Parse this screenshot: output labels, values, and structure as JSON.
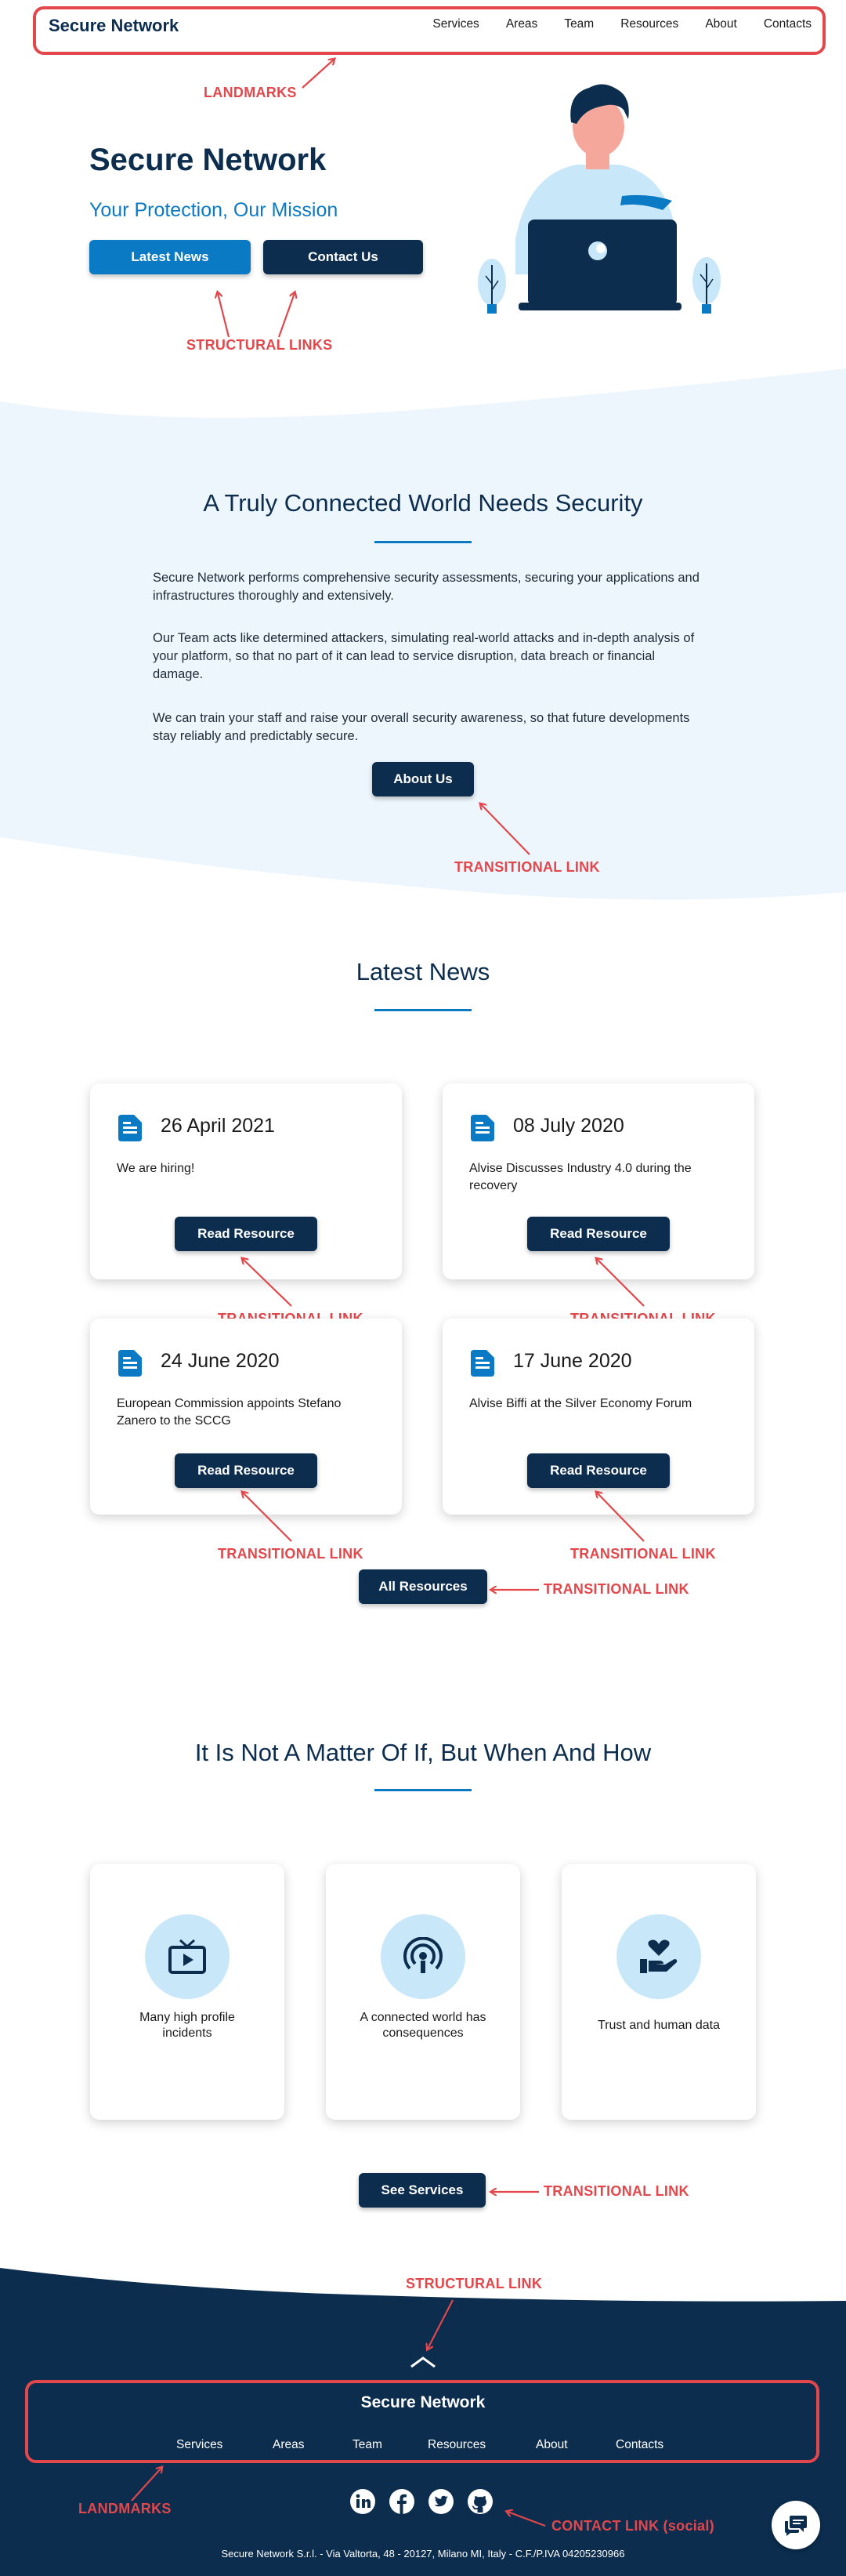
{
  "header": {
    "brand": "Secure Network",
    "nav": [
      "Services",
      "Areas",
      "Team",
      "Resources",
      "About",
      "Contacts"
    ]
  },
  "hero": {
    "title": "Secure Network",
    "subtitle": "Your Protection, Our Mission",
    "btn_news": "Latest News",
    "btn_contact": "Contact Us"
  },
  "security": {
    "title": "A Truly Connected World Needs Security",
    "paragraphs": [
      "Secure Network performs comprehensive security assessments, securing your applications and infrastructures thoroughly and extensively.",
      "Our Team acts like determined attackers, simulating real-world attacks and in-depth analysis of your platform, so that no part of it can lead to service disruption, data breach or financial damage.",
      "We can train your staff and raise your overall security awareness, so that future developments stay reliably and predictably secure."
    ],
    "button": "About Us"
  },
  "news": {
    "title": "Latest News",
    "items": [
      {
        "date": "26 April 2021",
        "text": "We are hiring!",
        "button": "Read Resource"
      },
      {
        "date": "08 July 2020",
        "text": "Alvise Discusses Industry 4.0 during the recovery",
        "button": "Read Resource"
      },
      {
        "date": "24 June 2020",
        "text": "European Commission appoints Stefano Zanero to the SCCG",
        "button": "Read Resource"
      },
      {
        "date": "17 June 2020",
        "text": "Alvise Biffi at the Silver Economy Forum",
        "button": "Read Resource"
      }
    ],
    "all_button": "All Resources"
  },
  "how": {
    "title": "It Is Not A Matter Of If, But When And How",
    "cards": [
      {
        "icon": "tv-play-icon",
        "caption": "Many high profile incidents"
      },
      {
        "icon": "podcast-signal-icon",
        "caption": "A connected world has consequences"
      },
      {
        "icon": "hand-heart-icon",
        "caption": "Trust and human data"
      }
    ],
    "button": "See Services"
  },
  "footer": {
    "brand": "Secure Network",
    "nav": [
      "Services",
      "Areas",
      "Team",
      "Resources",
      "About",
      "Contacts"
    ],
    "social": [
      "linkedin-icon",
      "facebook-icon",
      "twitter-icon",
      "github-icon"
    ],
    "legal": "Secure Network S.r.l. - Via Valtorta, 48 - 20127, Milano MI, Italy - C.F./P.IVA 04205230966"
  },
  "annotations": {
    "landmarks": "LANDMARKS",
    "structural": "STRUCTURAL LINKS",
    "transitional": "TRANSITIONAL LINK",
    "structural_single": "STRUCTURAL LINK",
    "contact": "CONTACT LINK (social)"
  },
  "colors": {
    "navy": "#0c2d4e",
    "blue": "#0b7ac4",
    "light_bg": "#eef6fd",
    "annotation_red": "#e2474b"
  }
}
